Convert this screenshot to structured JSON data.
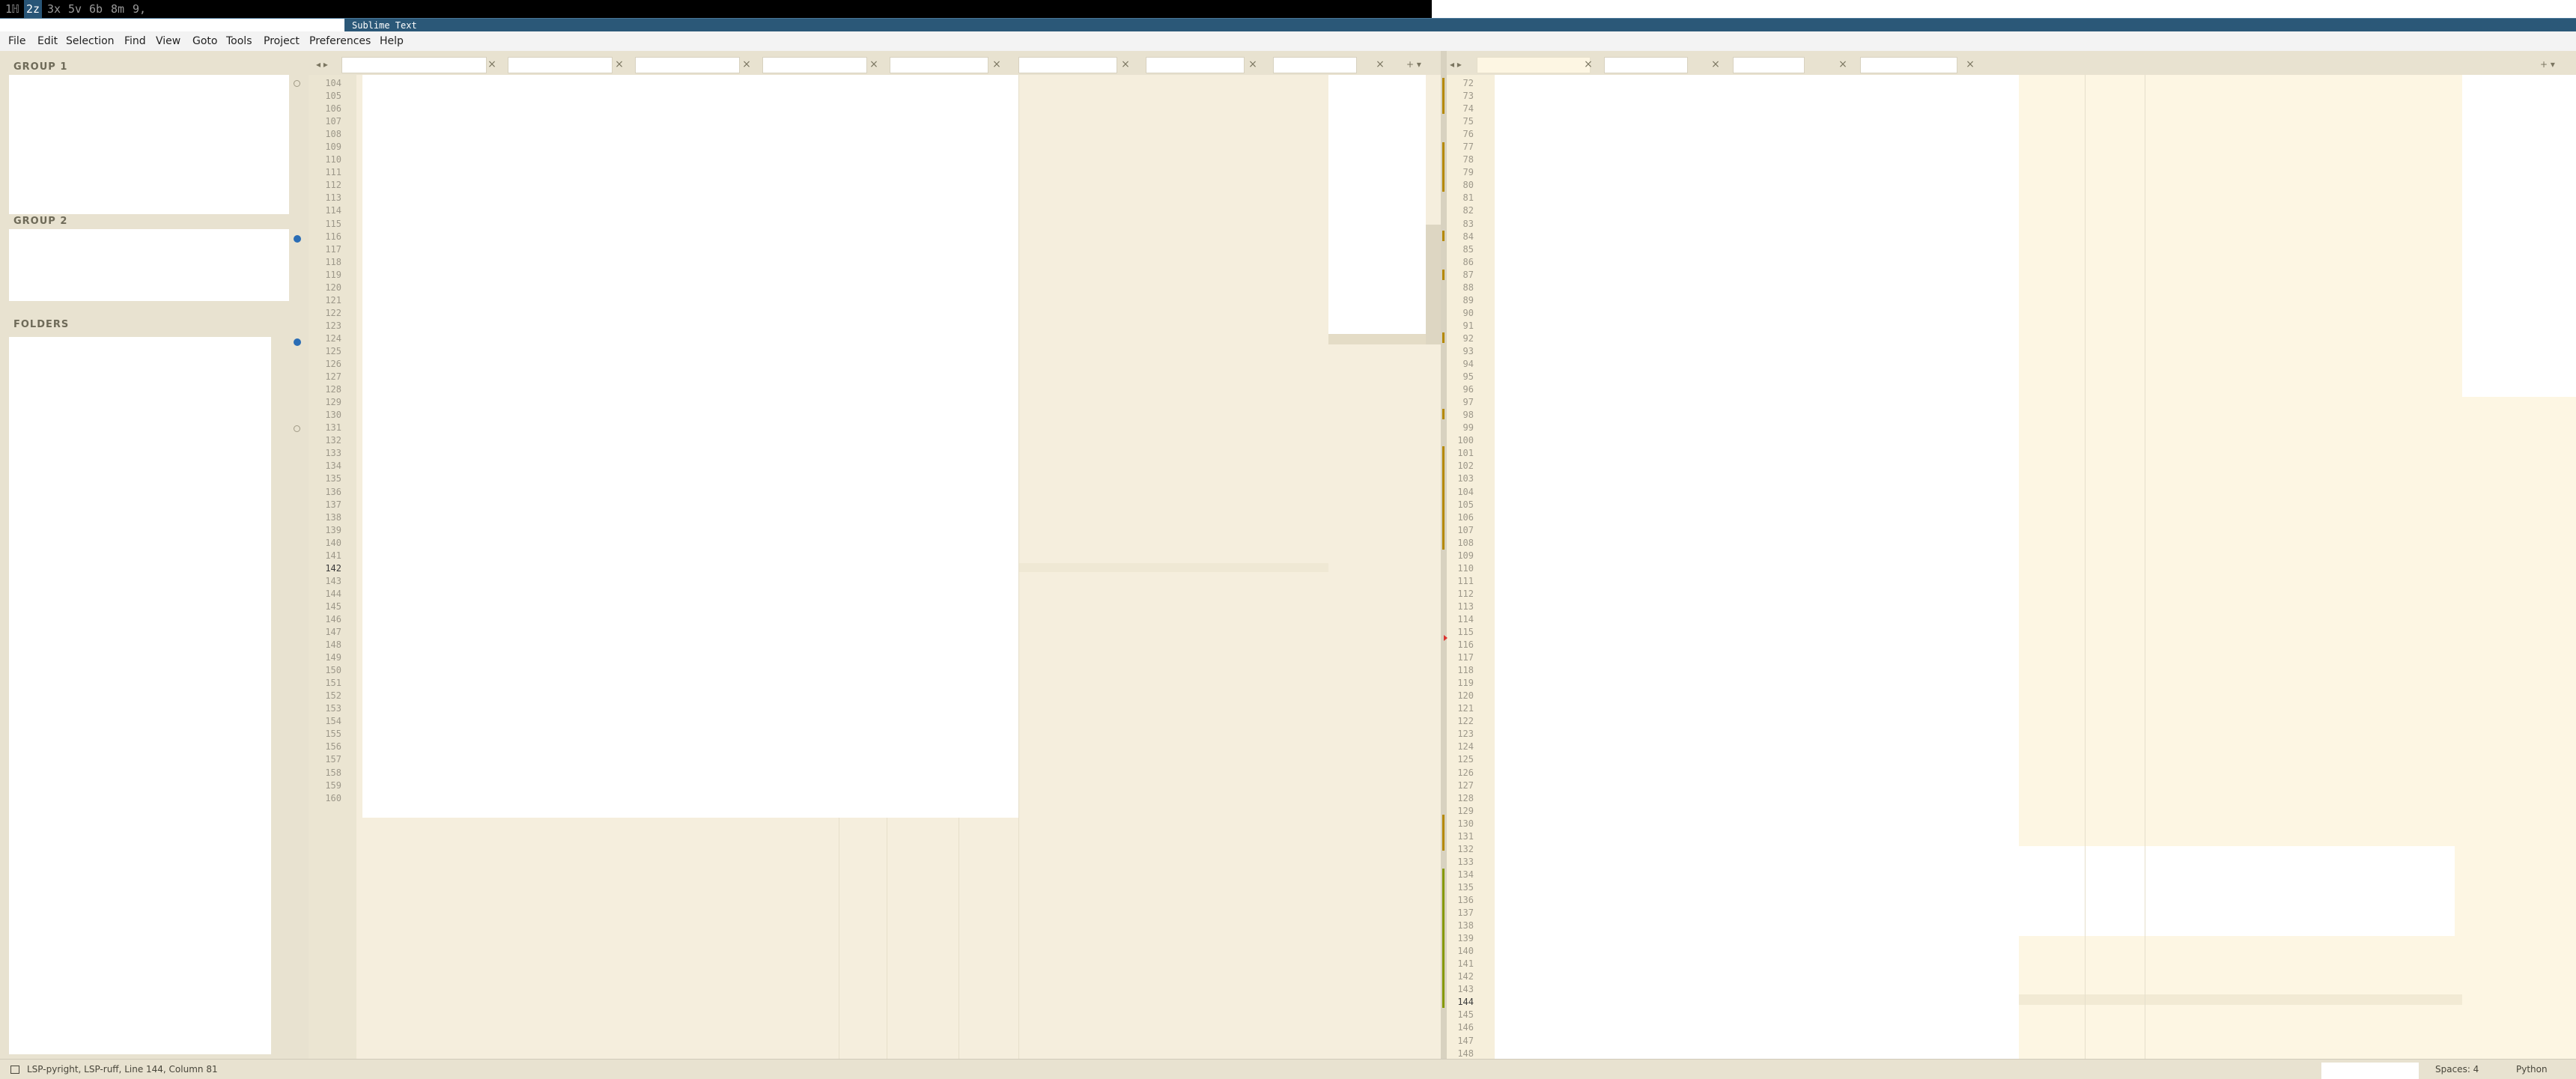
{
  "workspaces": [
    "1",
    "2",
    "3",
    "5",
    "6",
    "8",
    "9"
  ],
  "workspace_labels": [
    "1ℍ",
    "2z",
    "3x",
    "5v",
    "6b",
    "8m",
    "9,"
  ],
  "window_title": "Sublime Text",
  "menu": [
    "File",
    "Edit",
    "Selection",
    "Find",
    "View",
    "Goto",
    "Tools",
    "Project",
    "Preferences",
    "Help"
  ],
  "sidebar": {
    "group1": "GROUP 1",
    "group2": "GROUP 2",
    "folders": "FOLDERS"
  },
  "left_pane": {
    "line_start": 104,
    "line_end": 160,
    "current_line": 142
  },
  "right_pane": {
    "line_start": 72,
    "line_end": 148,
    "current_line": 144
  },
  "tab_close_glyph": "×",
  "statusbar": {
    "left_text": "LSP-pyright, LSP-ruff, Line 144, Column 81",
    "spaces": "Spaces: 4",
    "syntax": "Python"
  },
  "colors": {
    "title_bar": "#2b5878",
    "editor_bg": "#fdf6e3",
    "sidebar_bg": "#e8e2d0",
    "active_workspace": "#285577",
    "gutter_marker": "#2a6db5",
    "change_bar": "#b58900"
  }
}
